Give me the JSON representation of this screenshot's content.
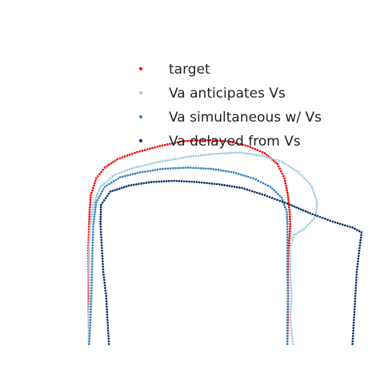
{
  "chart_data": {
    "type": "scatter",
    "title": "",
    "xlabel": "",
    "ylabel": "",
    "xlim": [
      0,
      10
    ],
    "ylim": [
      0,
      10
    ],
    "grid": false,
    "axes_visible": false,
    "legend_placement": "top-center",
    "series": [
      {
        "name": "target",
        "color": "#ff0000",
        "points": [
          [
            1.0,
            0.0
          ],
          [
            0.98,
            1.0
          ],
          [
            0.98,
            2.0
          ],
          [
            0.98,
            3.0
          ],
          [
            0.97,
            4.0
          ],
          [
            1.0,
            5.0
          ],
          [
            1.02,
            5.6
          ],
          [
            1.06,
            6.2
          ],
          [
            1.25,
            6.9
          ],
          [
            1.55,
            7.35
          ],
          [
            2.0,
            7.7
          ],
          [
            2.7,
            8.0
          ],
          [
            3.5,
            8.25
          ],
          [
            4.3,
            8.45
          ],
          [
            5.1,
            8.5
          ],
          [
            5.9,
            8.45
          ],
          [
            6.6,
            8.25
          ],
          [
            7.2,
            7.95
          ],
          [
            7.65,
            7.5
          ],
          [
            7.9,
            6.9
          ],
          [
            8.02,
            6.2
          ],
          [
            8.08,
            5.5
          ],
          [
            8.1,
            5.0
          ],
          [
            8.08,
            4.5
          ],
          [
            8.05,
            4.0
          ],
          [
            8.02,
            3.0
          ],
          [
            8.03,
            2.0
          ],
          [
            8.02,
            1.0
          ],
          [
            8.0,
            0.0
          ]
        ]
      },
      {
        "name": "Va anticipates Vs",
        "color": "#9ecae1",
        "points": [
          [
            0.98,
            0.0
          ],
          [
            0.98,
            1.0
          ],
          [
            1.02,
            2.0
          ],
          [
            1.0,
            3.0
          ],
          [
            1.0,
            4.0
          ],
          [
            1.05,
            5.0
          ],
          [
            1.15,
            5.8
          ],
          [
            1.4,
            6.55
          ],
          [
            1.9,
            7.05
          ],
          [
            2.6,
            7.35
          ],
          [
            3.5,
            7.6
          ],
          [
            4.5,
            7.8
          ],
          [
            5.4,
            7.92
          ],
          [
            6.3,
            7.98
          ],
          [
            7.1,
            7.85
          ],
          [
            7.8,
            7.6
          ],
          [
            8.4,
            7.15
          ],
          [
            8.85,
            6.6
          ],
          [
            9.05,
            5.9
          ],
          [
            9.0,
            5.3
          ],
          [
            8.6,
            4.8
          ],
          [
            8.25,
            4.55
          ],
          [
            8.1,
            4.0
          ],
          [
            8.1,
            3.0
          ],
          [
            8.15,
            2.0
          ],
          [
            8.1,
            1.0
          ],
          [
            8.2,
            0.0
          ]
        ]
      },
      {
        "name": "Va simultaneous w/ Vs",
        "color": "#3182bd",
        "points": [
          [
            1.0,
            0.0
          ],
          [
            1.05,
            1.0
          ],
          [
            1.08,
            2.0
          ],
          [
            1.1,
            3.0
          ],
          [
            1.12,
            4.0
          ],
          [
            1.15,
            5.0
          ],
          [
            1.25,
            5.9
          ],
          [
            1.55,
            6.55
          ],
          [
            2.1,
            6.95
          ],
          [
            2.8,
            7.15
          ],
          [
            3.6,
            7.3
          ],
          [
            4.5,
            7.35
          ],
          [
            5.3,
            7.3
          ],
          [
            6.1,
            7.15
          ],
          [
            6.8,
            6.9
          ],
          [
            7.4,
            6.55
          ],
          [
            7.8,
            6.1
          ],
          [
            7.98,
            5.5
          ],
          [
            8.0,
            5.0
          ],
          [
            8.0,
            4.0
          ],
          [
            8.0,
            3.0
          ],
          [
            8.02,
            2.0
          ],
          [
            8.0,
            1.0
          ],
          [
            8.0,
            0.0
          ]
        ]
      },
      {
        "name": "Va delayed from Vs",
        "color": "#08306b",
        "points": [
          [
            1.7,
            0.0
          ],
          [
            1.65,
            1.0
          ],
          [
            1.6,
            2.0
          ],
          [
            1.5,
            3.0
          ],
          [
            1.45,
            4.0
          ],
          [
            1.4,
            5.0
          ],
          [
            1.42,
            5.8
          ],
          [
            1.75,
            6.35
          ],
          [
            2.4,
            6.6
          ],
          [
            3.2,
            6.75
          ],
          [
            4.0,
            6.8
          ],
          [
            4.8,
            6.75
          ],
          [
            5.6,
            6.65
          ],
          [
            6.4,
            6.5
          ],
          [
            7.2,
            6.2
          ],
          [
            8.0,
            5.85
          ],
          [
            8.8,
            5.45
          ],
          [
            9.6,
            5.1
          ],
          [
            10.3,
            4.85
          ],
          [
            10.62,
            4.65
          ],
          [
            10.55,
            4.0
          ],
          [
            10.45,
            3.0
          ],
          [
            10.4,
            2.0
          ],
          [
            10.35,
            1.0
          ],
          [
            10.3,
            0.0
          ]
        ]
      }
    ]
  }
}
